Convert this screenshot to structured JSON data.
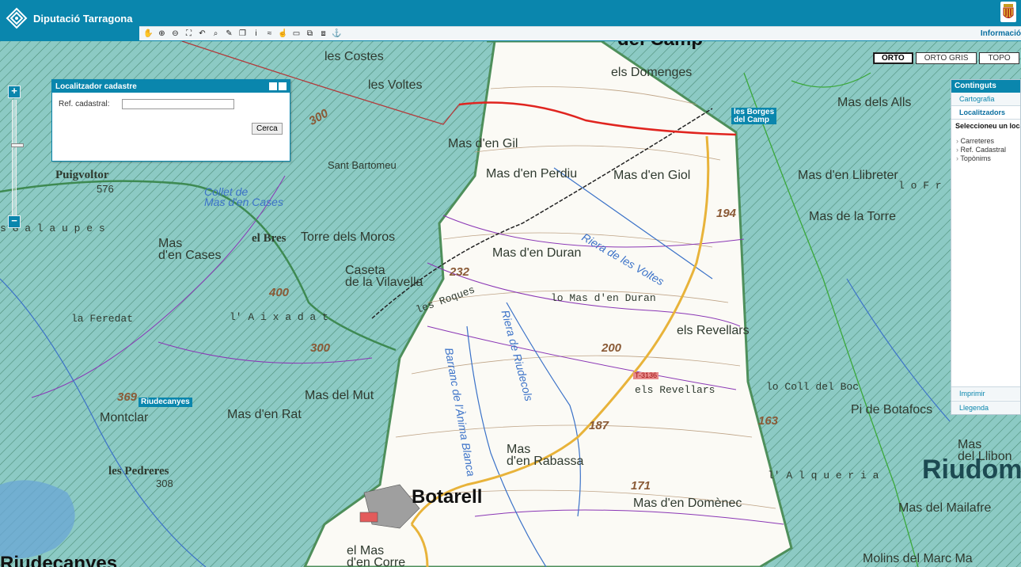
{
  "header": {
    "brand": "Diputació Tarragona",
    "info_link": "Informació",
    "tools": [
      {
        "icon": "hand-pan-icon",
        "glyph": "✋"
      },
      {
        "icon": "zoom-in-icon",
        "glyph": "⊕"
      },
      {
        "icon": "zoom-out-icon",
        "glyph": "⊖"
      },
      {
        "icon": "zoom-extent-icon",
        "glyph": "⛶"
      },
      {
        "icon": "zoom-previous-icon",
        "glyph": "↶"
      },
      {
        "icon": "zoom-window-icon",
        "glyph": "⌕"
      },
      {
        "icon": "measure-icon",
        "glyph": "✎"
      },
      {
        "icon": "layers-icon",
        "glyph": "❐"
      },
      {
        "icon": "info-icon",
        "glyph": "i"
      },
      {
        "icon": "coordinates-icon",
        "glyph": "≈"
      },
      {
        "icon": "pointer-icon",
        "glyph": "☝"
      },
      {
        "icon": "comment-icon",
        "glyph": "▭"
      },
      {
        "icon": "print-preview-icon",
        "glyph": "⧉"
      },
      {
        "icon": "export-icon",
        "glyph": "⧈"
      },
      {
        "icon": "anchor-icon",
        "glyph": "⚓"
      }
    ]
  },
  "layers": {
    "buttons": [
      "ORTO",
      "ORTO GRIS",
      "TOPO"
    ],
    "active": "ORTO"
  },
  "cadastre_panel": {
    "title": "Localitzador cadastre",
    "label": "Ref. cadastral:",
    "input_value": "",
    "search_button": "Cerca"
  },
  "contents_panel": {
    "title": "Continguts",
    "tabs": [
      "Cartografia",
      "Localitzadors"
    ],
    "active_tab": "Localitzadors",
    "select_label": "Seleccioneu un localitzador",
    "items": [
      "Carreteres",
      "Ref. Cadastral",
      "Topònims"
    ],
    "footer": [
      "Imprimir",
      "Llegenda"
    ]
  },
  "map_labels": [
    {
      "text": "les Costes",
      "cls": ""
    },
    {
      "text": "les Voltes",
      "cls": ""
    },
    {
      "text": "els Domenges",
      "cls": ""
    },
    {
      "text": "del Camp",
      "cls": "big"
    },
    {
      "text": "Mas dels Alls",
      "cls": ""
    },
    {
      "text": "les Borges del Camp",
      "cls": "badge"
    },
    {
      "text": "300",
      "cls": "elev"
    },
    {
      "text": "Mas d'en Gil",
      "cls": ""
    },
    {
      "text": "Sant Bartomeu",
      "cls": "sm"
    },
    {
      "text": "Mas d'en Perdiu",
      "cls": ""
    },
    {
      "text": "Mas d'en Giol",
      "cls": ""
    },
    {
      "text": "Mas d'en Llibreter",
      "cls": ""
    },
    {
      "text": "l o   F r",
      "cls": "mono"
    },
    {
      "text": "Puigvoltor",
      "cls": "serif"
    },
    {
      "text": "576",
      "cls": "sm"
    },
    {
      "text": "Collet de Mas d'en Cases",
      "cls": "river"
    },
    {
      "text": "194",
      "cls": "elev"
    },
    {
      "text": "Mas de la Torre",
      "cls": ""
    },
    {
      "text": "s  G a l a u p e s",
      "cls": "mono"
    },
    {
      "text": "el Bres",
      "cls": "serif"
    },
    {
      "text": "Torre dels Moros",
      "cls": ""
    },
    {
      "text": "Mas d'en Cases",
      "cls": ""
    },
    {
      "text": "Riera de les Voltes",
      "cls": "river"
    },
    {
      "text": "Mas d'en Duran",
      "cls": ""
    },
    {
      "text": "Caseta de la Vilavella",
      "cls": ""
    },
    {
      "text": "232",
      "cls": "elev"
    },
    {
      "text": "400",
      "cls": "elev"
    },
    {
      "text": "lo Mas d'en Duran",
      "cls": "mono"
    },
    {
      "text": "les Roques",
      "cls": "mono"
    },
    {
      "text": "la Feredat",
      "cls": "mono"
    },
    {
      "text": "l' A i x a d a t",
      "cls": "mono"
    },
    {
      "text": "els Revellars",
      "cls": ""
    },
    {
      "text": "Riera de Riudecols",
      "cls": "river"
    },
    {
      "text": "Barranc de l'Ànima Blanca",
      "cls": "river"
    },
    {
      "text": "200",
      "cls": "elev"
    },
    {
      "text": "300",
      "cls": "elev"
    },
    {
      "text": "T-3136",
      "cls": "road"
    },
    {
      "text": "els Revellars",
      "cls": "mono"
    },
    {
      "text": "lo Coll del Boc",
      "cls": "mono"
    },
    {
      "text": "369",
      "cls": "elev"
    },
    {
      "text": "Riudecanyes",
      "cls": "badge"
    },
    {
      "text": "Mas del Mut",
      "cls": ""
    },
    {
      "text": "Pi de Botafocs",
      "cls": ""
    },
    {
      "text": "Montclar",
      "cls": ""
    },
    {
      "text": "Mas d'en Rat",
      "cls": ""
    },
    {
      "text": "187",
      "cls": "elev"
    },
    {
      "text": "163",
      "cls": "elev"
    },
    {
      "text": "Mas d'en Rabassa",
      "cls": ""
    },
    {
      "text": "Mas del Llibon",
      "cls": ""
    },
    {
      "text": "les Pedreres",
      "cls": "serif"
    },
    {
      "text": "308",
      "cls": "sm"
    },
    {
      "text": "l' A l q u e r i a",
      "cls": "mono"
    },
    {
      "text": "Riudoms",
      "cls": "huge"
    },
    {
      "text": "171",
      "cls": "elev"
    },
    {
      "text": "Botarell",
      "cls": "big"
    },
    {
      "text": "Mas d'en Domènec",
      "cls": ""
    },
    {
      "text": "Mas del Mailafre",
      "cls": ""
    },
    {
      "text": "el Mas d'en Corre",
      "cls": ""
    },
    {
      "text": "Riudecanyes",
      "cls": "big"
    },
    {
      "text": "Molins del Marc Ma",
      "cls": ""
    }
  ]
}
